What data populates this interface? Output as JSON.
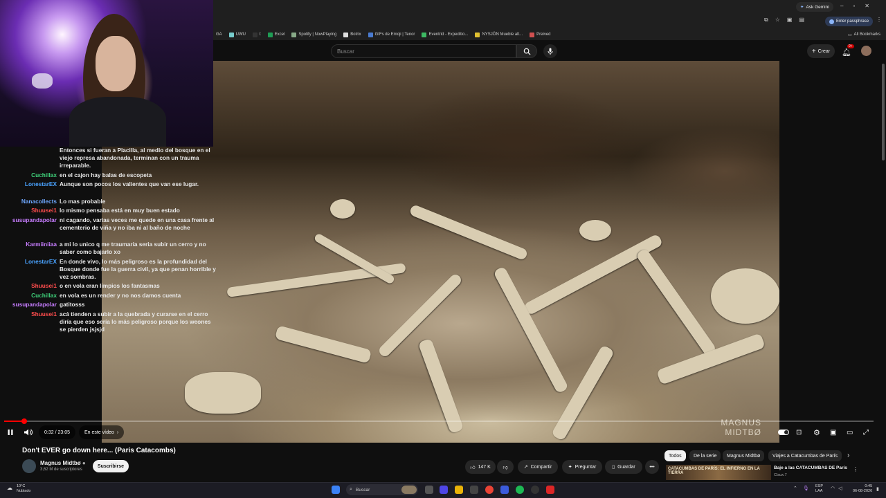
{
  "browser": {
    "ask_gemini": "Ask Gemini",
    "passphrase": "Enter passphrase",
    "all_bookmarks": "All Bookmarks",
    "bookmarks": [
      "GA",
      "UWU",
      "t",
      "Excel",
      "Spotify | NowPlaying",
      "Botrix",
      "GIFs de Emoji | Tenor",
      "Eventrid - Expeditio...",
      "NYSJÖN Mueble alt...",
      "Preived"
    ]
  },
  "youtube": {
    "search_placeholder": "Buscar",
    "create_label": "Crear",
    "notifications_badge": "9+",
    "video_title": "Don't EVER go down here... (Paris Catacombs)",
    "channel_name": "Magnus Midtbø",
    "subscribers": "3,62 M de suscriptores",
    "subscribe_label": "Suscribirse",
    "likes": "147 K",
    "share_label": "Compartir",
    "ask_label": "Preguntar",
    "save_label": "Guardar",
    "chips": [
      "Todos",
      "De la serie",
      "Magnus Midtbø",
      "Viajes a Catacumbas de París"
    ],
    "rec_thumb_text": "CATACUMBAS DE PARÍS: EL INFIERNO EN LA TIERRA",
    "rec_title": "Baje a las CATACUMBAS DE París",
    "rec_channel": "Claux.7"
  },
  "player": {
    "time": "0:32 / 23:05",
    "chapter": "En este vídeo",
    "progress": 0.023,
    "watermark_line1": "MAGNUS",
    "watermark_line2": "MIDTBØ"
  },
  "chat": [
    {
      "user": "",
      "color": "#e9e9e9",
      "text": "Entonces si fueran a Placilla, al medio del bosque en el viejo represa abandonada, terminan con un trauma irreparable."
    },
    {
      "user": "Cuchillax",
      "color": "#3fd17a",
      "text": "en el cajon hay balas de escopeta"
    },
    {
      "user": "LonestarEX",
      "color": "#4aa3ff",
      "text": "Aunque son pocos los valientes que van ese lugar."
    },
    {
      "user": "Nanacollects",
      "color": "#6fa8ff",
      "text": "Lo mas probable"
    },
    {
      "user": "Shuusei1",
      "color": "#ff4d4d",
      "text": "lo mismo pensaba está en muy buen estado"
    },
    {
      "user": "susupandapolar",
      "color": "#c77dff",
      "text": "ni cagando, varias veces me quede en una casa frente al cementerio de viña y no iba ni al baño de noche"
    },
    {
      "user": "Karmiiniiaa",
      "color": "#c77dff",
      "text": "a mi lo unico q me traumaria seria subir un cerro y no saber como bajarlo xo"
    },
    {
      "user": "LonestarEX",
      "color": "#4aa3ff",
      "text": "En donde vivo, lo más peligroso es la profundidad del Bosque donde fue la guerra civil, ya que penan horrible y vez sombras."
    },
    {
      "user": "Shuusei1",
      "color": "#ff4d4d",
      "text": "o en vola eran limpios los fantasmas"
    },
    {
      "user": "Cuchillax",
      "color": "#3fd17a",
      "text": "en vola es un render y no nos damos cuenta"
    },
    {
      "user": "susupandapolar",
      "color": "#c77dff",
      "text": "gatitosss"
    },
    {
      "user": "Shuusei1",
      "color": "#ff4d4d",
      "text": "acá tienden a subir a la quebrada y curarse en el cerro diría que eso sería lo más peligroso porque los weones se pierden jsjsjd"
    }
  ],
  "taskbar": {
    "weather_temp": "10°C",
    "weather_desc": "Nublado",
    "search_label": "Buscar",
    "lang1": "ESP",
    "lang2": "LAA",
    "time": "0:45",
    "date": "06-08-2026"
  },
  "colors": {
    "accent_red": "#ff0000",
    "bg": "#0f0f0f"
  }
}
